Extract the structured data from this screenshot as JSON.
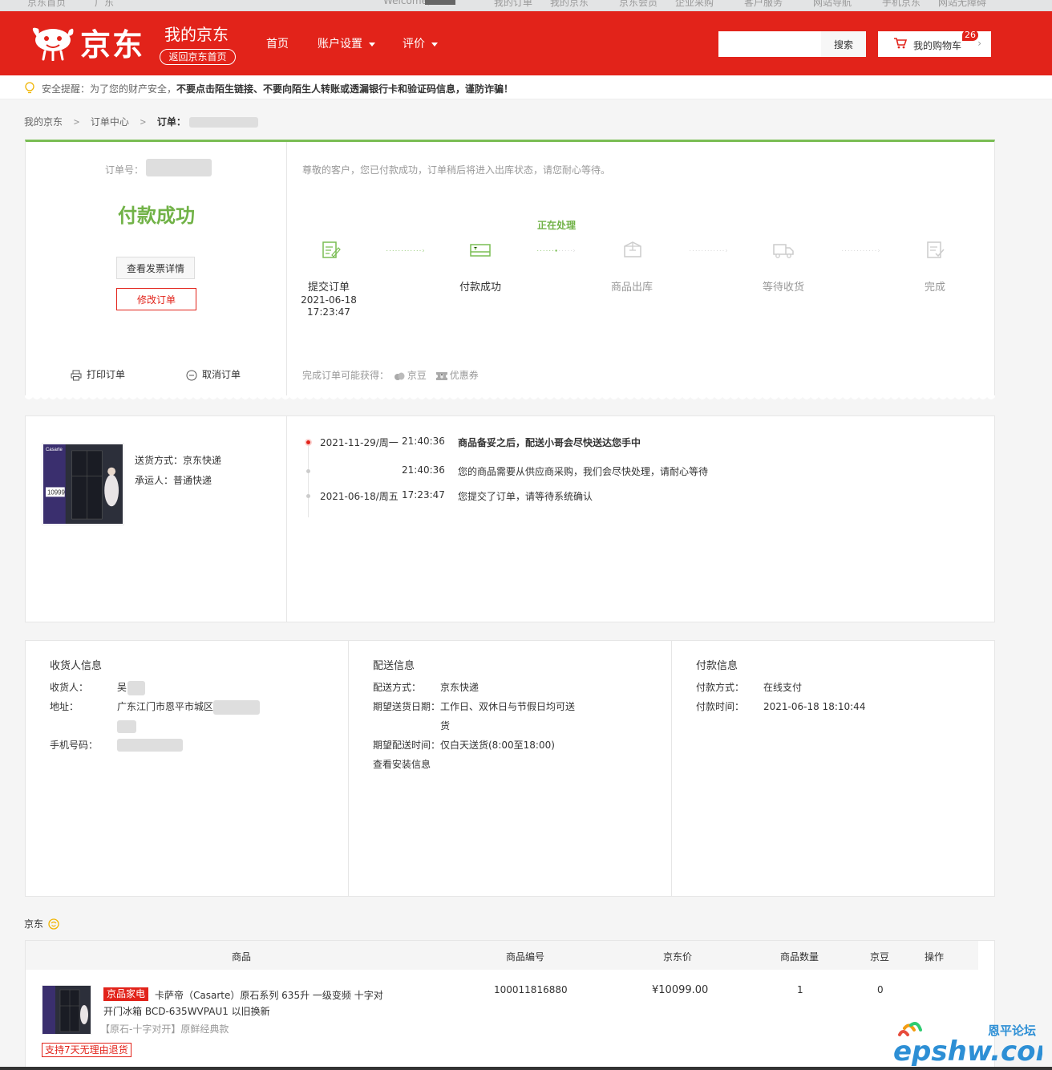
{
  "topbar": {
    "links": [
      "京东首页",
      "广东",
      "Welcome,",
      "我的订单",
      "我的京东",
      "京东会员",
      "企业采购",
      "客户服务",
      "网站导航",
      "手机京东",
      "网站无障碍"
    ]
  },
  "header": {
    "logo_text": "京东",
    "my_jd": "我的京东",
    "back_home": "返回京东首页",
    "nav": [
      {
        "label": "首页",
        "dropdown": false
      },
      {
        "label": "账户设置",
        "dropdown": true
      },
      {
        "label": "评价",
        "dropdown": true
      }
    ],
    "search": {
      "placeholder": "",
      "button": "搜索"
    },
    "cart": {
      "label": "我的购物车",
      "count": "26",
      "arrow": "›"
    }
  },
  "notice": {
    "prefix": "安全提醒：为了您的财产安全，",
    "bold": "不要点击陌生链接、不要向陌生人转账或透漏银行卡和验证码信息，谨防诈骗",
    "suffix": "！"
  },
  "breadcrumb": {
    "items": [
      "我的京东",
      "订单中心"
    ],
    "current_label": "订单：",
    "sep": ">"
  },
  "order_status": {
    "order_no_label": "订单号：",
    "status": "付款成功",
    "invoice_button": "查看发票详情",
    "modify_button": "修改订单",
    "print_label": "打印订单",
    "cancel_label": "取消订单",
    "message": "尊敬的客户，您已付款成功，订单稍后将进入出库状态，请您耐心等待。",
    "processing_label": "正在处理",
    "steps": [
      {
        "label": "提交订单",
        "date": "2021-06-18",
        "time": "17:23:47",
        "state": "done"
      },
      {
        "label": "付款成功",
        "date": "",
        "time": "",
        "state": "done"
      },
      {
        "label": "商品出库",
        "date": "",
        "time": "",
        "state": "todo"
      },
      {
        "label": "等待收货",
        "date": "",
        "time": "",
        "state": "todo"
      },
      {
        "label": "完成",
        "date": "",
        "time": "",
        "state": "todo"
      }
    ],
    "reward_prefix": "完成订单可能获得：",
    "reward_beans": "京豆",
    "reward_coupon": "优惠券"
  },
  "logistics": {
    "ship_method": "送货方式：京东快递",
    "carrier": "承运人：普通快递",
    "product_thumb_price": "10999",
    "product_thumb_brand": "Casarte",
    "events": [
      {
        "date": "2021-11-29/周一",
        "time": "21:40:36",
        "text": "商品备妥之后，配送小哥会尽快送达您手中",
        "highlight": true
      },
      {
        "date": "",
        "time": "21:40:36",
        "text": "您的商品需要从供应商采购，我们会尽快处理，请耐心等待",
        "highlight": false
      },
      {
        "date": "2021-06-18/周五",
        "time": "17:23:47",
        "text": "您提交了订单，请等待系统确认",
        "highlight": false
      }
    ]
  },
  "info": {
    "receiver": {
      "title": "收货人信息",
      "name_label": "收货人：",
      "name_value": "吴",
      "address_label": "地址：",
      "address_value": "广东江门市恩平市城区",
      "phone_label": "手机号码："
    },
    "delivery": {
      "title": "配送信息",
      "method_label": "配送方式：",
      "method_value": "京东快递",
      "date_label": "期望送货日期：",
      "date_value_1": "工作日、双休日与节假日均可送",
      "date_value_2": "货",
      "time_label": "期望配送时间：",
      "time_value": "仅白天送货(8:00至18:00)",
      "install_link": "查看安装信息"
    },
    "payment": {
      "title": "付款信息",
      "method_label": "付款方式：",
      "method_value": "在线支付",
      "time_label": "付款时间：",
      "time_value": "2021-06-18 18:10:44"
    }
  },
  "goods": {
    "shop": "京东",
    "headers": [
      "商品",
      "商品编号",
      "京东价",
      "商品数量",
      "京豆",
      "操作"
    ],
    "item": {
      "tag": "京品家电",
      "name": "卡萨帝（Casarte）原石系列 635升 一级变频 十字对开门冰箱 BCD-635WVPAU1 以旧换新",
      "spec": "【原石-十字对开】原鲜经典款",
      "return_tag": "支持7天无理由退货",
      "sku": "100011816880",
      "price": "¥10099.00",
      "qty": "1",
      "beans": "0"
    }
  },
  "watermark": {
    "cn": "恩平论坛",
    "en": "epshw.com"
  },
  "colors": {
    "brand_red": "#e2231a",
    "success_green": "#71b247",
    "progress_green": "#7abd54"
  }
}
